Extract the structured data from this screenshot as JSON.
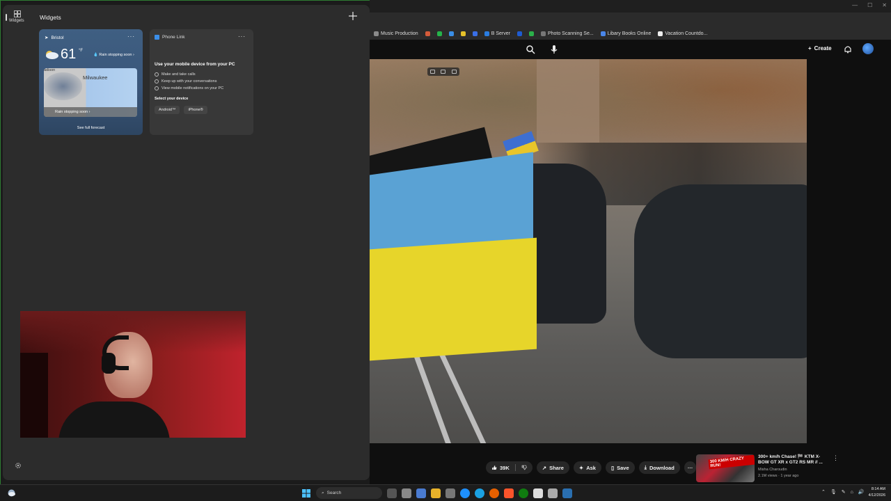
{
  "browser": {
    "bookmarks": [
      {
        "label": "Music Production",
        "color": "#8a8a8a"
      },
      {
        "label": "",
        "color": "#d45b3a"
      },
      {
        "label": "",
        "color": "#25b34a"
      },
      {
        "label": "",
        "color": "#3a8ee6"
      },
      {
        "label": "",
        "color": "#e6c12a"
      },
      {
        "label": "",
        "color": "#3a6fe6"
      },
      {
        "label": "B Server",
        "color": "#2a7de1"
      },
      {
        "label": "",
        "color": "#1e5bd1"
      },
      {
        "label": "",
        "color": "#2bb04a"
      },
      {
        "label": "Photo Scanning Se...",
        "color": "#777777"
      },
      {
        "label": "Libary Books Online",
        "color": "#4a86e8"
      },
      {
        "label": "Vacation Countdo...",
        "color": "#eeeeee"
      }
    ],
    "youtube": {
      "create_label": "Create",
      "actions": {
        "likes": "39K",
        "share": "Share",
        "ask": "Ask",
        "save": "Save",
        "download": "Download"
      },
      "recommendation": {
        "thumb_badge": "300 KM/H CRAZY RUN!",
        "title": "300+ km/h Chase! 🏁 KTM X-BOW GT XR x GT2 RS MR // ...",
        "channel": "Misha Charoudin",
        "meta": "2.1M views · 1 year ago"
      }
    }
  },
  "widgets": {
    "nav_label": "Widgets",
    "title": "Widgets",
    "weather": {
      "location": "Bristol",
      "temperature": "61",
      "unit": "°F",
      "condition": "Rain stopping soon",
      "map_city": "Milwaukee",
      "map_city_partial": "adison",
      "map_caption": "Rain stopping soon",
      "forecast_link": "See full forecast"
    },
    "phone_link": {
      "title": "Phone Link",
      "heading": "Use your mobile device from your PC",
      "features": [
        "Make and take calls",
        "Keep up with your conversations",
        "View mobile notifications on your PC"
      ],
      "select_label": "Select your device",
      "android_button": "Android™",
      "iphone_button": "iPhone®"
    }
  },
  "taskbar": {
    "search_placeholder": "Search",
    "time": "8:14 AM",
    "date": "4/12/2026"
  }
}
